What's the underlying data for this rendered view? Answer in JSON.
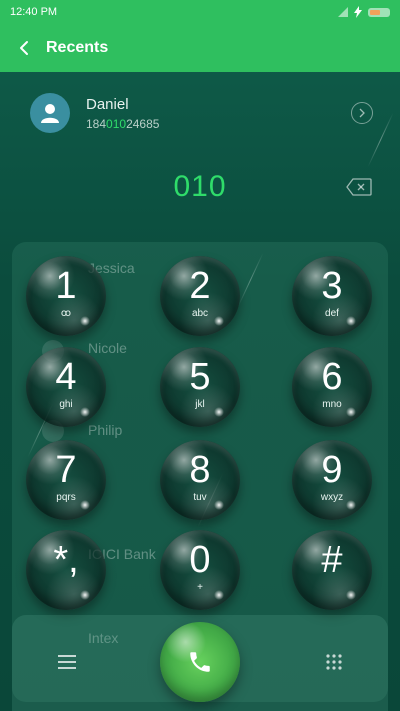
{
  "status_bar": {
    "time": "12:40 PM"
  },
  "app_bar": {
    "title": "Recents"
  },
  "suggestion": {
    "name": "Daniel",
    "number_prefix": "184",
    "number_match": "010",
    "number_suffix": "24685"
  },
  "dialer": {
    "number": "010"
  },
  "keypad": {
    "keys": [
      {
        "digit": "1",
        "letters": "ꝏ"
      },
      {
        "digit": "2",
        "letters": "abc"
      },
      {
        "digit": "3",
        "letters": "def"
      },
      {
        "digit": "4",
        "letters": "ghi"
      },
      {
        "digit": "5",
        "letters": "jkl"
      },
      {
        "digit": "6",
        "letters": "mno"
      },
      {
        "digit": "7",
        "letters": "pqrs"
      },
      {
        "digit": "8",
        "letters": "tuv"
      },
      {
        "digit": "9",
        "letters": "wxyz"
      },
      {
        "digit": "*,",
        "letters": ""
      },
      {
        "digit": "0",
        "letters": "+"
      },
      {
        "digit": "#",
        "letters": ""
      }
    ]
  },
  "background_list": {
    "items": [
      {
        "name": "Jessica"
      },
      {
        "name": "Nicole"
      },
      {
        "name": "Philip"
      },
      {
        "name": "ICICI Bank"
      },
      {
        "name": "Intex"
      }
    ]
  },
  "colors": {
    "accent": "#2fbf5f",
    "match_highlight": "#2fdc6a",
    "background": "#0b4c3d"
  }
}
